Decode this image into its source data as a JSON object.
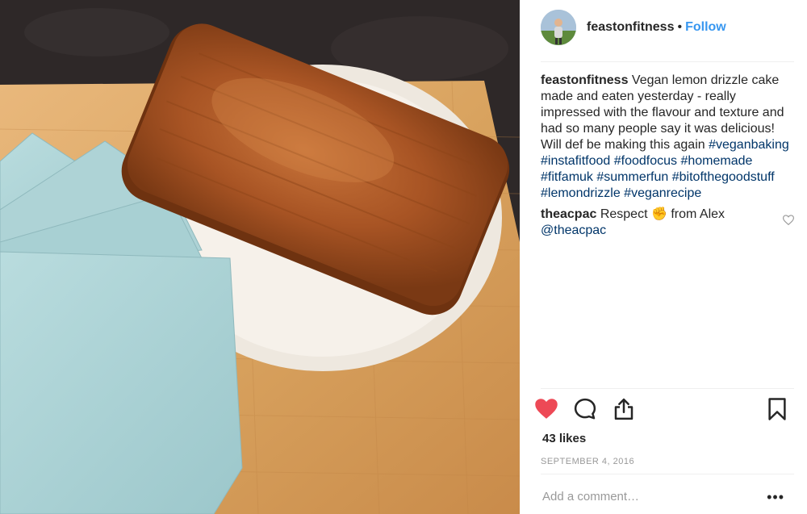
{
  "post": {
    "username": "feastonfitness",
    "separator": "•",
    "follow_label": "Follow"
  },
  "caption": {
    "username": "feastonfitness",
    "text": "Vegan lemon drizzle cake made and eaten yesterday - really impressed with the flavour and texture and had so many people say it was delicious! Will def be making this again",
    "hashtags": [
      "#veganbaking",
      "#instafitfood",
      "#foodfocus",
      "#homemade",
      "#fitfamuk",
      "#summerfun",
      "#bitofthegoodstuff",
      "#lemondrizzle",
      "#veganrecipe"
    ]
  },
  "comment": {
    "username": "theacpac",
    "text_before": "Respect",
    "emoji": "✊",
    "text_after": "from Alex",
    "mention": "@theacpac"
  },
  "actions": {
    "liked": true,
    "like_icon": "heart-filled-icon",
    "comment_icon": "comment-bubble-icon",
    "share_icon": "share-upload-icon",
    "save_icon": "bookmark-icon",
    "like_color": "#ed4956"
  },
  "likes_text": "43 likes",
  "date_text": "SEPTEMBER 4, 2016",
  "comment_input": {
    "placeholder": "Add a comment…"
  },
  "more_label": "•••",
  "colors": {
    "link": "#3897f0",
    "hashtag": "#003569",
    "muted": "#999999"
  }
}
